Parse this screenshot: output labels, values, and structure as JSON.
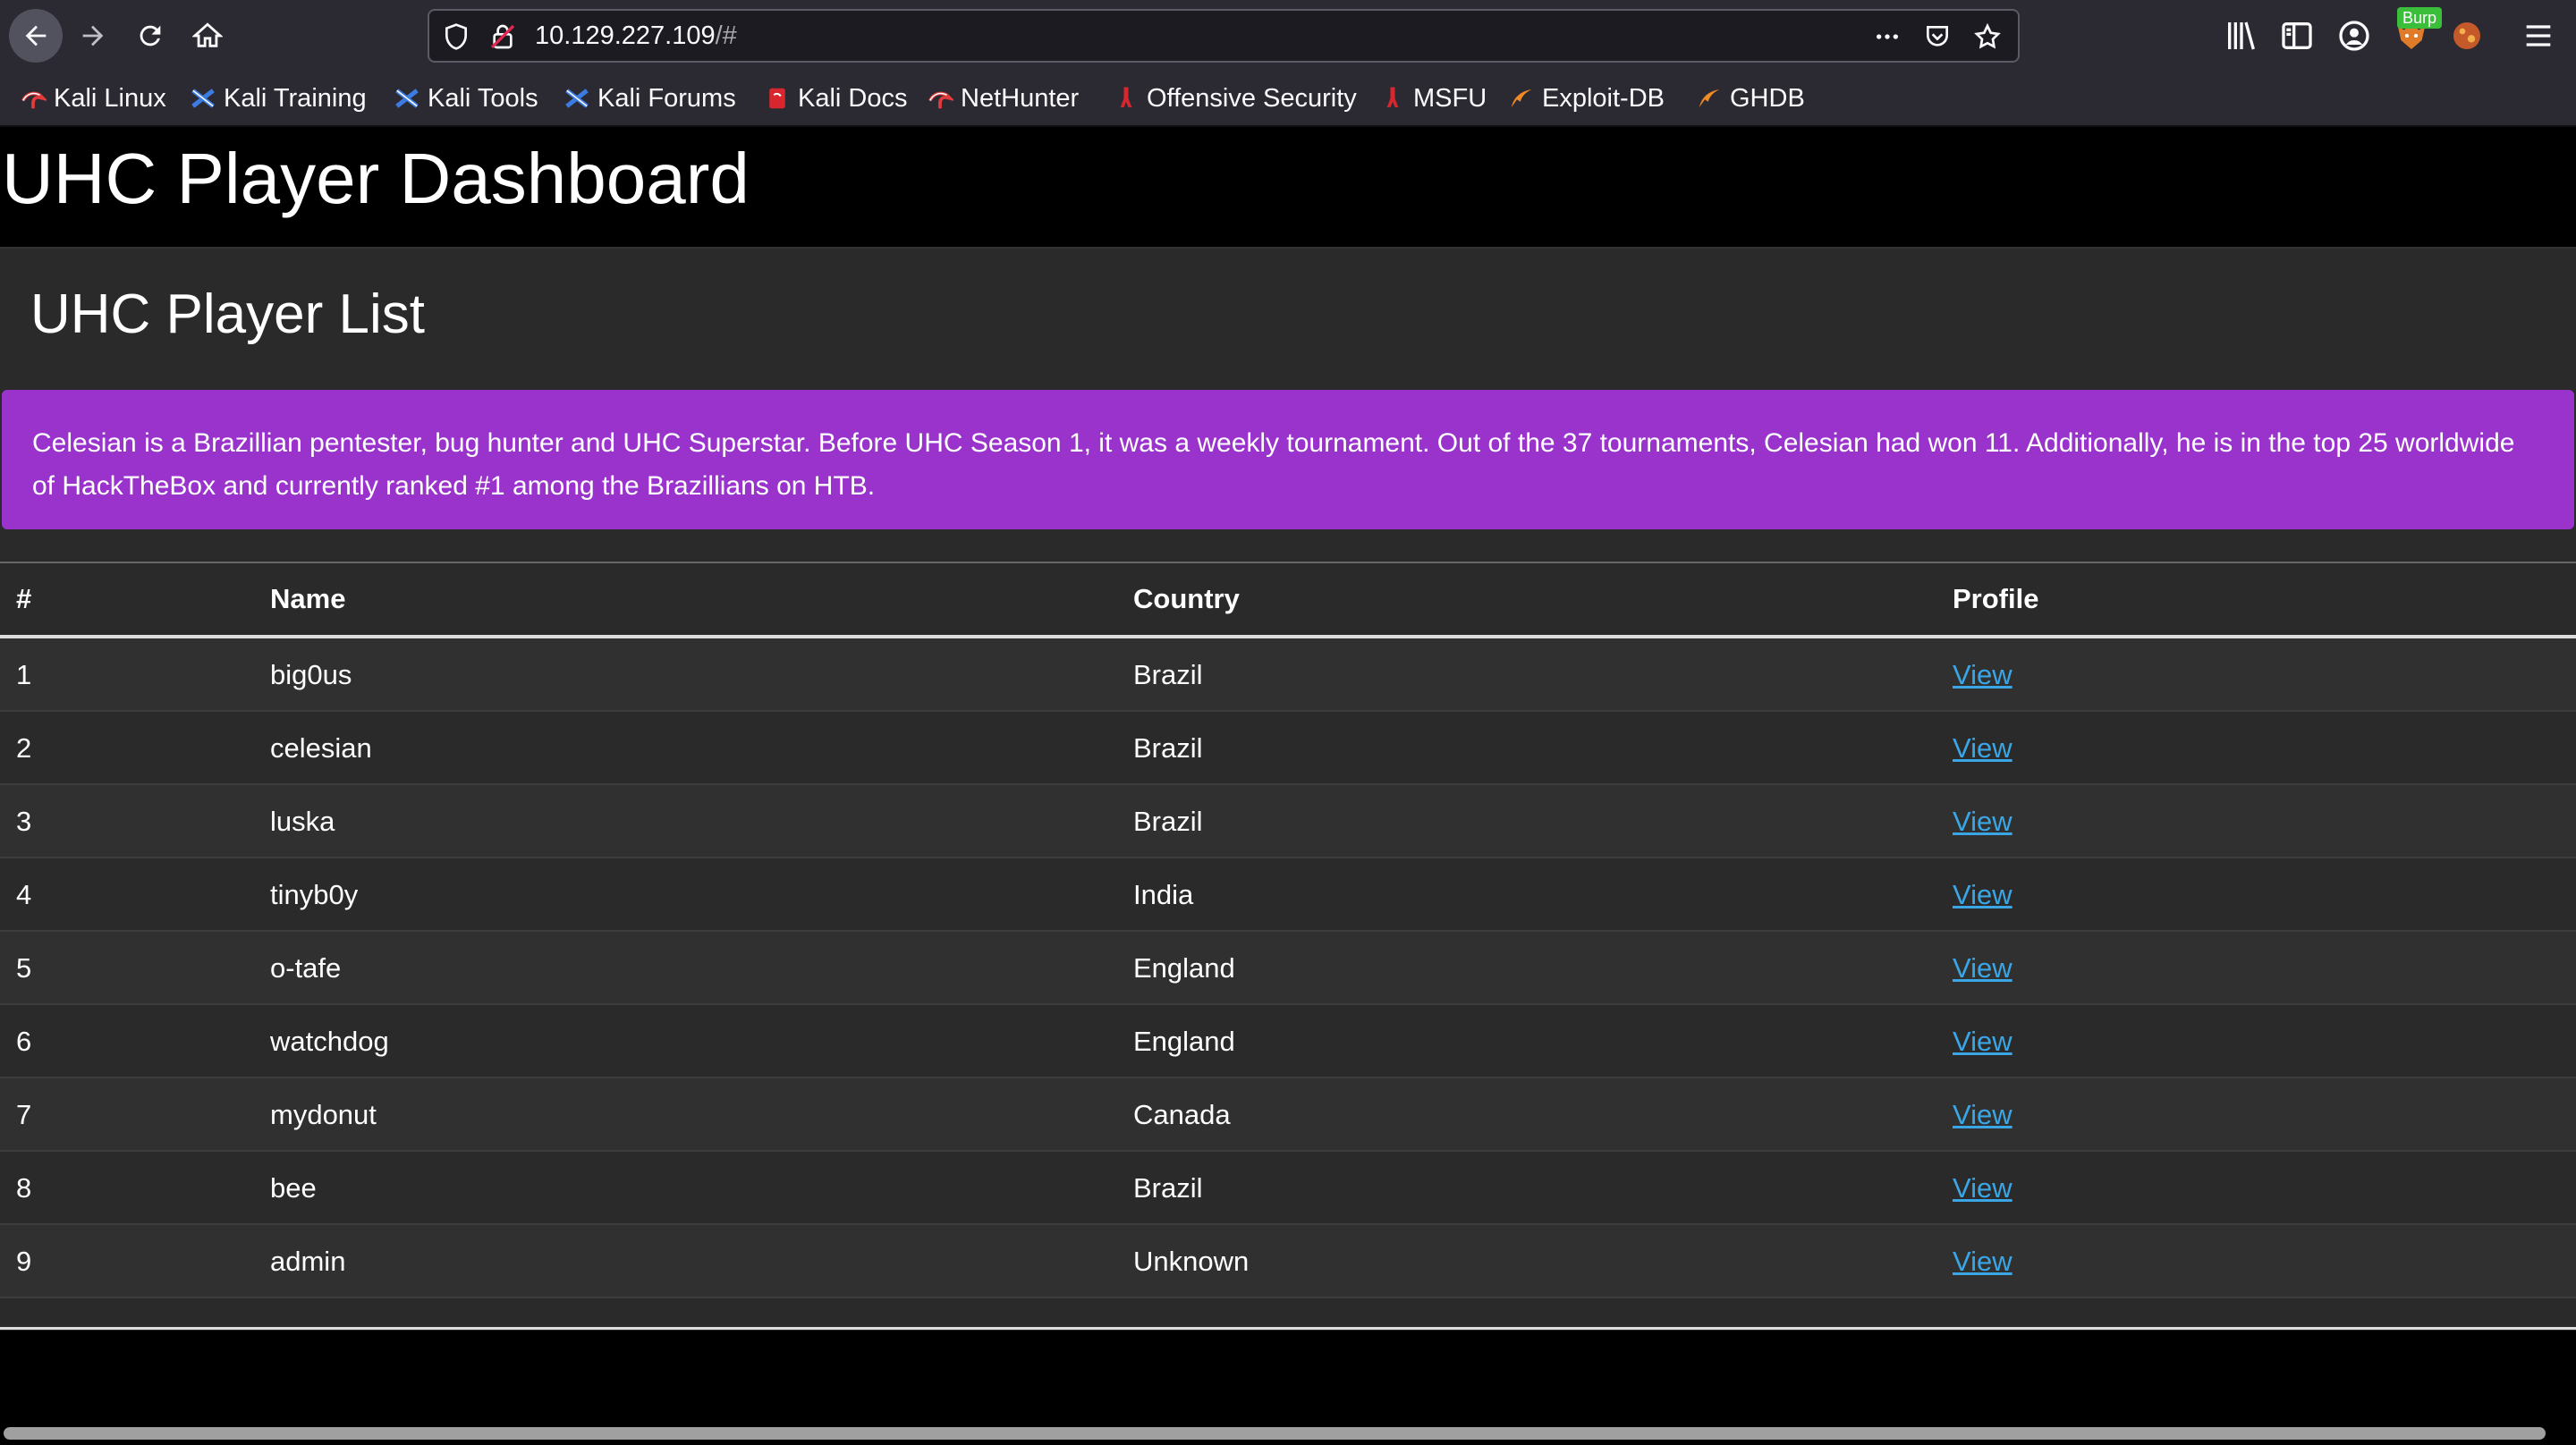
{
  "browser": {
    "url_host": "10.129.227.109",
    "url_rest": "/#",
    "burp_badge": "Burp",
    "nav_icons": [
      "back-icon",
      "forward-icon",
      "reload-icon",
      "home-icon"
    ],
    "right_icons": [
      "library-icon",
      "sidebar-icon",
      "account-icon",
      "foxyproxy-icon",
      "extension-icon",
      "menu-icon"
    ]
  },
  "bookmarks": [
    {
      "label": "Kali Linux",
      "icon": "kali-dragon-icon"
    },
    {
      "label": "Kali Training",
      "icon": "kali-training-icon"
    },
    {
      "label": "Kali Tools",
      "icon": "kali-tools-icon"
    },
    {
      "label": "Kali Forums",
      "icon": "kali-forums-icon"
    },
    {
      "label": "Kali Docs",
      "icon": "kali-docs-icon"
    },
    {
      "label": "NetHunter",
      "icon": "nethunter-icon"
    },
    {
      "label": "Offensive Security",
      "icon": "offsec-icon"
    },
    {
      "label": "MSFU",
      "icon": "msfu-icon"
    },
    {
      "label": "Exploit-DB",
      "icon": "exploitdb-icon"
    },
    {
      "label": "GHDB",
      "icon": "ghdb-icon"
    }
  ],
  "page": {
    "title": "UHC Player Dashboard",
    "card_title": "UHC Player List",
    "alert": "Celesian is a Brazillian pentester, bug hunter and UHC Superstar. Before UHC Season 1, it was a weekly tournament. Out of the 37 tournaments, Celesian had won 11. Additionally, he is in the top 25 worldwide of HackTheBox and currently ranked #1 among the Brazillians on HTB."
  },
  "table": {
    "headers": [
      "#",
      "Name",
      "Country",
      "Profile"
    ],
    "rows": [
      {
        "num": "1",
        "name": "big0us",
        "country": "Brazil",
        "profile": "View"
      },
      {
        "num": "2",
        "name": "celesian",
        "country": "Brazil",
        "profile": "View"
      },
      {
        "num": "3",
        "name": "luska",
        "country": "Brazil",
        "profile": "View"
      },
      {
        "num": "4",
        "name": "tinyb0y",
        "country": "India",
        "profile": "View"
      },
      {
        "num": "5",
        "name": "o-tafe",
        "country": "England",
        "profile": "View"
      },
      {
        "num": "6",
        "name": "watchdog",
        "country": "England",
        "profile": "View"
      },
      {
        "num": "7",
        "name": "mydonut",
        "country": "Canada",
        "profile": "View"
      },
      {
        "num": "8",
        "name": "bee",
        "country": "Brazil",
        "profile": "View"
      },
      {
        "num": "9",
        "name": "admin",
        "country": "Unknown",
        "profile": "View"
      }
    ]
  },
  "colors": {
    "alert_bg": "#9933cc",
    "link": "#3aa6e6",
    "card_bg": "#2a2a2a",
    "toolbar_bg": "#2b2a33"
  }
}
